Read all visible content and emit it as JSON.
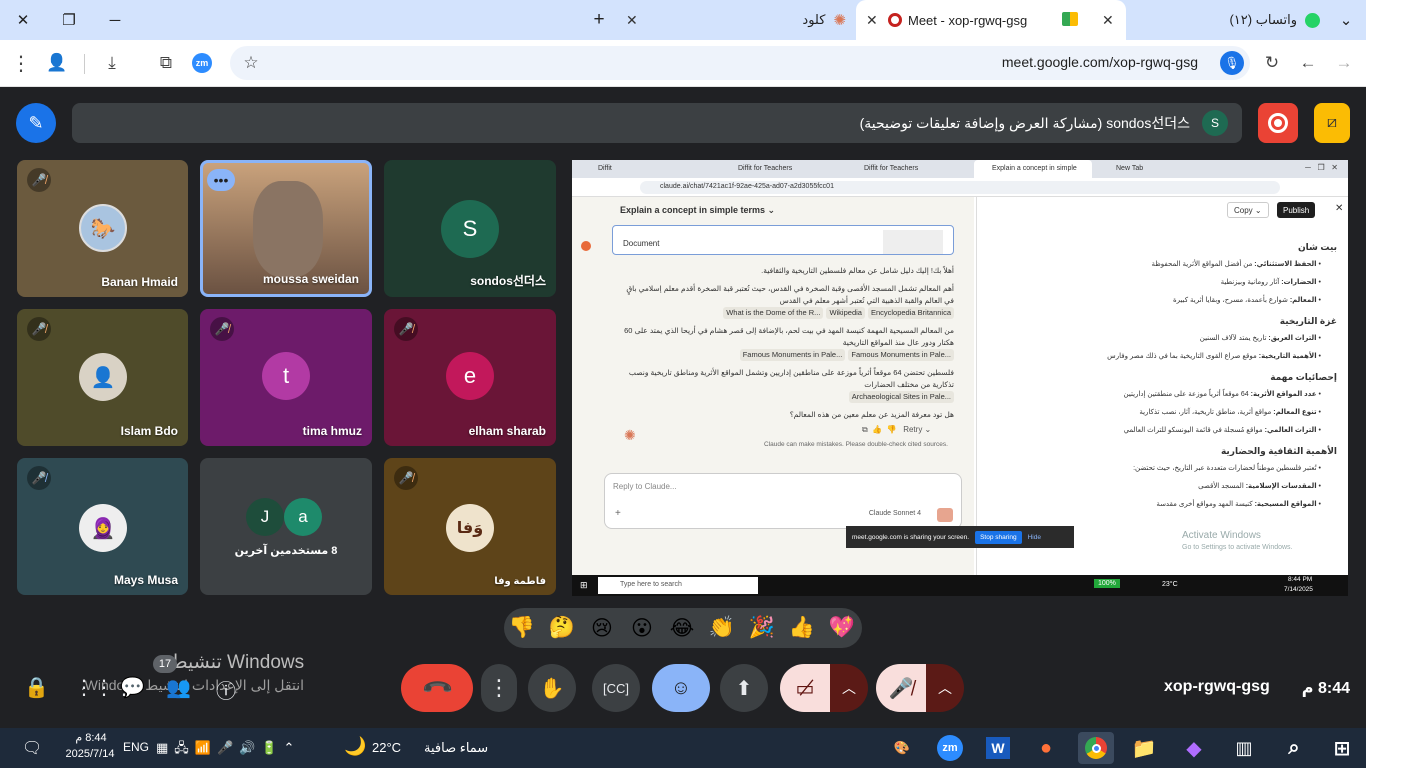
{
  "browser": {
    "tabs": [
      {
        "title": "واتساب (١٢)",
        "icon": "whatsapp-icon"
      },
      {
        "title": "Meet - xop-rgwq-gsg",
        "icon": "meet-icon"
      },
      {
        "title": "كلود",
        "icon": "claude-icon"
      }
    ],
    "url": "meet.google.com/xop-rgwq-gsg"
  },
  "meet": {
    "presenter_banner": "sondos선더스 (مشاركة العرض وإضافة تعليقات توضيحية)",
    "presenter_initial": "S",
    "participants": [
      {
        "name": "Banan Hmaid",
        "muted": true
      },
      {
        "name": "moussa sweidan",
        "muted": false
      },
      {
        "name": "sondos선더스",
        "initial": "S",
        "color": "#1e6a52"
      },
      {
        "name": "Islam Bdo",
        "muted": true
      },
      {
        "name": "tima hmuz",
        "initial": "t",
        "color": "#b23aa4",
        "muted": true
      },
      {
        "name": "elham sharab",
        "initial": "e",
        "color": "#c2185b",
        "muted": true
      },
      {
        "name": "Mays Musa",
        "muted": true
      },
      {
        "name": "8 مستخدمين آخرين",
        "initials": [
          "J",
          "a"
        ]
      },
      {
        "name": "فاطمة وفا",
        "avatar_text": "وَفا",
        "muted": true
      }
    ],
    "meeting_code": "xop-rgwq-gsg",
    "time": "8:44 م",
    "people_count": "17",
    "reactions": [
      "👎",
      "🤔",
      "😢",
      "😮",
      "😂",
      "👏",
      "🎉",
      "👍",
      "💖"
    ],
    "watermark_title": "تنشيط Windows",
    "watermark_sub": "انتقل إلى الإعدادات لتنشيط Windows."
  },
  "shared": {
    "tabs": [
      "Diffit",
      "Diffit for Teachers",
      "Diffit for Teachers",
      "Explain a concept in simple",
      "New Tab"
    ],
    "url": "claude.ai/chat/7421ac1f-92ae-425a-ad07-a2d3055fcc01",
    "chat_title": "Explain a concept in simple terms ⌄",
    "document_label": "Document",
    "intro": "أهلاً بك! إليك دليل شامل عن معالم فلسطين التاريخية والثقافية.",
    "para1": "أهم المعالم تشمل المسجد الأقصى وقبة الصخرة في القدس، حيث تُعتبر قبة الصخرة أقدم معلم إسلامي باقٍ في العالم والقبة الذهبية التي تُعتبر أشهر معلم في القدس",
    "chips1": [
      "Encyclopedia Britannica",
      "Wikipedia",
      "What is the Dome of the R..."
    ],
    "para2": "من المعالم المسيحية المهمة كنيسة المهد في بيت لحم، بالإضافة إلى قصر هشام في أريحا الذي يمتد على 60 هكتار ودور عال منذ المواقع التاريخية",
    "chips2": [
      "Famous Monuments in Pale...",
      "Famous Monuments in Pale..."
    ],
    "para3": "فلسطين تحتضن 64 موقعاً أثرياً موزعة على مناطقين إداريين وتشمل المواقع الأثرية ومناطق تاريخية ونصب تذكارية من مختلف الحضارات",
    "chips3": [
      "Archaeological Sites in Pale..."
    ],
    "question": "هل تود معرفة المزيد عن معلم معين من هذه المعالم؟",
    "retry": "Retry",
    "disclaimer": "Claude can make mistakes. Please double-check cited sources.",
    "reply_placeholder": "Reply to Claude...",
    "model": "Claude Sonnet 4",
    "copy": "Copy",
    "publish": "Publish",
    "artifact": [
      {
        "h": "بيت شان",
        "items": [
          {
            "b": "الحفظ الاستثنائي:",
            "t": "من أفضل المواقع الأثرية المحفوظة"
          },
          {
            "b": "الحضارات:",
            "t": "آثار رومانية وبيزنطية"
          },
          {
            "b": "المعالم:",
            "t": "شوارع بأعمدة، مسرح، وبقايا أثرية كبيرة"
          }
        ]
      },
      {
        "h": "غزة التاريخية",
        "items": [
          {
            "b": "التراث العريق:",
            "t": "تاريخ يمتد لآلاف السنين"
          },
          {
            "b": "الأهمية التاريخية:",
            "t": "موقع صراع القوى التاريخية بما في ذلك مصر وفارس"
          }
        ]
      },
      {
        "h": "إحصائيات مهمة",
        "items": [
          {
            "b": "عدد المواقع الأثرية:",
            "t": "64 موقعاً أثرياً موزعة على منطقتين إداريتين"
          },
          {
            "b": "تنوع المعالم:",
            "t": "مواقع أثرية، مناطق تاريخية، آثار، نصب تذكارية"
          },
          {
            "b": "التراث العالمي:",
            "t": "مواقع مُسجلة في قائمة اليونسكو للتراث العالمي"
          }
        ]
      },
      {
        "h": "الأهمية الثقافية والحضارية",
        "items": [
          {
            "b": "",
            "t": "تُعتبر فلسطين موطناً لحضارات متعددة عبر التاريخ، حيث تحتضن:"
          },
          {
            "b": "المقدسات الإسلامية:",
            "t": "المسجد الأقصى"
          },
          {
            "b": "المواقع المسيحية:",
            "t": "كنيسة المهد ومواقع أخرى مقدسة"
          }
        ]
      }
    ],
    "sharing_notice": "meet.google.com is sharing your screen.",
    "stop_sharing": "Stop sharing",
    "hide": "Hide",
    "activate_title": "Activate Windows",
    "activate_sub": "Go to Settings to activate Windows.",
    "search_placeholder": "Type here to search",
    "battery": "100%",
    "temp": "23°C",
    "time": "8:44 PM",
    "date": "7/14/2025"
  },
  "taskbar": {
    "time": "8:44 م",
    "date": "2025/7/14",
    "lang": "ENG",
    "weather_temp": "22°C",
    "weather_text": "سماء صافية"
  },
  "colors": {
    "accent": "#1a73e8",
    "end_call": "#ea4335",
    "meet_bg": "#202124",
    "tab_bg": "#d3e3fd"
  }
}
